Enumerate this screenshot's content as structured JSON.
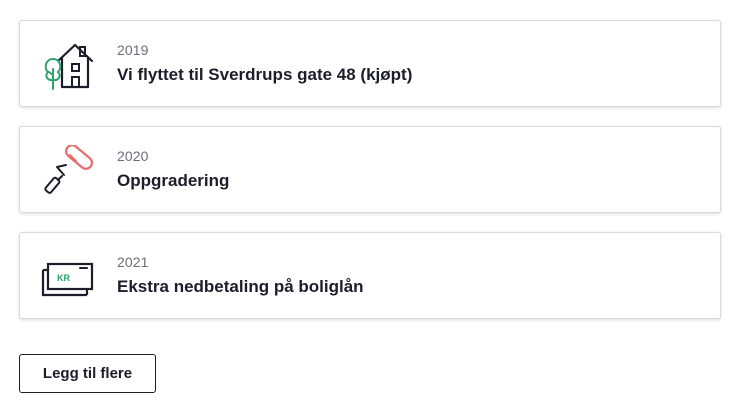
{
  "events": [
    {
      "year": "2019",
      "title": "Vi flyttet til Sverdrups gate 48 (kjøpt)",
      "icon": "house-icon"
    },
    {
      "year": "2020",
      "title": "Oppgradering",
      "icon": "paint-roller-icon"
    },
    {
      "year": "2021",
      "title": "Ekstra nedbetaling på boliglån",
      "icon": "money-icon"
    }
  ],
  "money_icon_text": "KR",
  "add_more_label": "Legg til flere",
  "colors": {
    "text": "#1d1d2b",
    "muted": "#6d6d78",
    "green": "#2ea36b",
    "red": "#ea6b6b",
    "border": "#d9d9de"
  }
}
